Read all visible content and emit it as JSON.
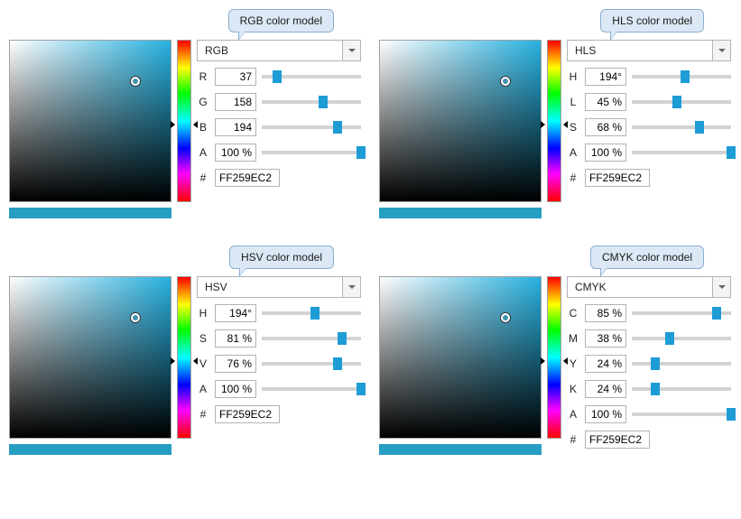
{
  "preview_color": "#259ec2",
  "pickers": [
    {
      "callout": "RGB color model",
      "mode": "RGB",
      "channels": [
        {
          "label": "R",
          "value": "37",
          "pos": 0.15
        },
        {
          "label": "G",
          "value": "158",
          "pos": 0.62
        },
        {
          "label": "B",
          "value": "194",
          "pos": 0.76
        },
        {
          "label": "A",
          "value": "100 %",
          "pos": 1.0
        }
      ],
      "hex_label": "#",
      "hex_value": "FF259EC2"
    },
    {
      "callout": "HLS color model",
      "mode": "HLS",
      "channels": [
        {
          "label": "H",
          "value": "194°",
          "pos": 0.54
        },
        {
          "label": "L",
          "value": "45 %",
          "pos": 0.45
        },
        {
          "label": "S",
          "value": "68 %",
          "pos": 0.68
        },
        {
          "label": "A",
          "value": "100 %",
          "pos": 1.0
        }
      ],
      "hex_label": "#",
      "hex_value": "FF259EC2"
    },
    {
      "callout": "HSV color model",
      "mode": "HSV",
      "channels": [
        {
          "label": "H",
          "value": "194°",
          "pos": 0.54
        },
        {
          "label": "S",
          "value": "81 %",
          "pos": 0.81
        },
        {
          "label": "V",
          "value": "76 %",
          "pos": 0.76
        },
        {
          "label": "A",
          "value": "100 %",
          "pos": 1.0
        }
      ],
      "hex_label": "#",
      "hex_value": "FF259EC2"
    },
    {
      "callout": "CMYK color model",
      "mode": "CMYK",
      "channels": [
        {
          "label": "C",
          "value": "85 %",
          "pos": 0.85
        },
        {
          "label": "M",
          "value": "38 %",
          "pos": 0.38
        },
        {
          "label": "Y",
          "value": "24 %",
          "pos": 0.24
        },
        {
          "label": "K",
          "value": "24 %",
          "pos": 0.24
        },
        {
          "label": "A",
          "value": "100 %",
          "pos": 1.0
        }
      ],
      "hex_label": "#",
      "hex_value": "FF259EC2"
    }
  ]
}
